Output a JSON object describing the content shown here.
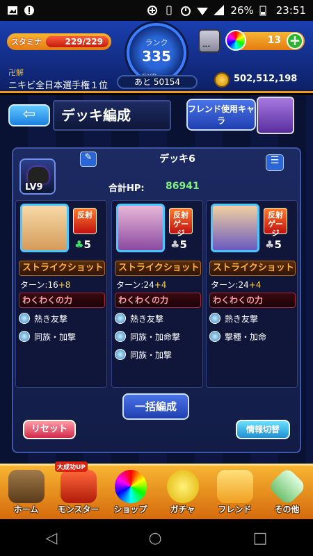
{
  "statusbar": {
    "battery": "26%",
    "time": "23:51"
  },
  "hud": {
    "stamina_label": "スタミナ",
    "stamina_value": "229/229",
    "stamina_fraction": 1.0,
    "rank_label": "ランク",
    "rank_value": "335",
    "exp_label": "EXP",
    "exp_next": "あと 50154",
    "box_label": "---",
    "orb_count": "13",
    "title_label": "卍解",
    "title_value": "ニキビ全日本選手権１位",
    "gold": "502,512,198"
  },
  "header": {
    "page_title": "デッキ編成",
    "friend_button": "フレンド使用キャラ"
  },
  "deck": {
    "name": "デッキ6",
    "leader_level": "LV9",
    "total_hp_label": "合計HP:",
    "total_hp_value": "86941",
    "monsters": [
      {
        "type_badge": "反射",
        "luck": "5",
        "strike_shot": "ストライクショット",
        "turn_base": "ターン:16",
        "turn_plus": "+8",
        "special": "わくわくの力",
        "abilities": [
          "熱き友撃",
          "同族・加撃"
        ]
      },
      {
        "type_badge": "反射 ゲージ",
        "luck": "5",
        "strike_shot": "ストライクショット",
        "turn_base": "ターン:24",
        "turn_plus": "+4",
        "special": "わくわくの力",
        "abilities": [
          "熱き友撃",
          "同族・加命撃",
          "同族・加撃"
        ]
      },
      {
        "type_badge": "反射 ゲージ",
        "luck": "5",
        "strike_shot": "ストライクショット",
        "turn_base": "ターン:24",
        "turn_plus": "+4",
        "special": "わくわくの力",
        "abilities": [
          "熱き友撃",
          "撃種・加命"
        ]
      }
    ]
  },
  "actions": {
    "bulk": "一括編成",
    "reset": "リセット",
    "info_toggle": "情報切替"
  },
  "nav": {
    "promo": "大成功UP",
    "items": [
      "ホーム",
      "モンスター",
      "ショップ",
      "ガチャ",
      "フレンド",
      "その他"
    ]
  },
  "colors": {
    "accent_orange": "#f29a12",
    "panel_blue": "#1c2a62",
    "hp_green": "#7ef07e"
  }
}
